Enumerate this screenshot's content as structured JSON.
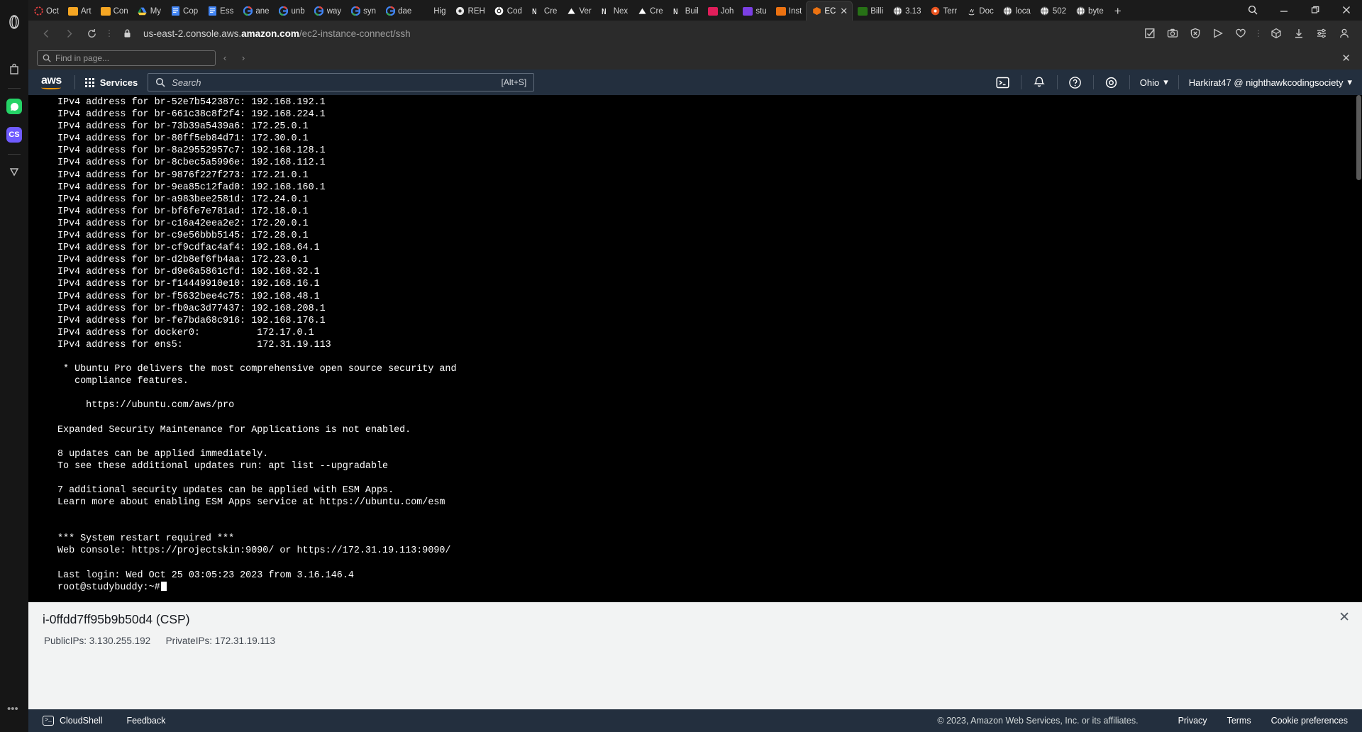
{
  "browser": {
    "tabs": [
      {
        "label": "Oct",
        "icon": "clock-icon",
        "color": "#e84040"
      },
      {
        "label": "Art",
        "icon": "note-icon",
        "color": "#f5a623"
      },
      {
        "label": "Con",
        "icon": "note-icon",
        "color": "#f5a623"
      },
      {
        "label": "My",
        "icon": "google-drive-icon",
        "color": "#2196f3"
      },
      {
        "label": "Cop",
        "icon": "google-docs-icon",
        "color": "#4285f4"
      },
      {
        "label": "Ess",
        "icon": "google-docs-icon",
        "color": "#4285f4"
      },
      {
        "label": "ane",
        "icon": "google-icon",
        "color": "#ffffff"
      },
      {
        "label": "unb",
        "icon": "google-icon",
        "color": "#ffffff"
      },
      {
        "label": "way",
        "icon": "google-icon",
        "color": "#ffffff"
      },
      {
        "label": "syn",
        "icon": "google-icon",
        "color": "#ffffff"
      },
      {
        "label": "dae",
        "icon": "google-icon",
        "color": "#ffffff"
      },
      {
        "label": "Hig",
        "icon": "blank-icon",
        "color": "#888888"
      },
      {
        "label": "REH",
        "icon": "circle-icon",
        "color": "#dddddd"
      },
      {
        "label": "Cod",
        "icon": "gitlab-icon",
        "color": "#ffffff"
      },
      {
        "label": "Cre",
        "icon": "netlify-icon",
        "color": "#ffffff"
      },
      {
        "label": "Ver",
        "icon": "vercel-icon",
        "color": "#ffffff"
      },
      {
        "label": "Nex",
        "icon": "netlify-icon",
        "color": "#ffffff"
      },
      {
        "label": "Cre",
        "icon": "vercel-icon",
        "color": "#ffffff"
      },
      {
        "label": "Buil",
        "icon": "netlify-icon",
        "color": "#ffffff"
      },
      {
        "label": "Joh",
        "icon": "slack-icon",
        "color": "#e01e5a"
      },
      {
        "label": "stu",
        "icon": "discord-icon",
        "color": "#7b3fe4"
      },
      {
        "label": "Inst",
        "icon": "instance-icon",
        "color": "#ec7211"
      },
      {
        "label": "EC",
        "icon": "aws-ec2-icon",
        "color": "#ec7211",
        "active": true,
        "closable": true
      },
      {
        "label": "Billi",
        "icon": "aws-billing-icon",
        "color": "#277116"
      },
      {
        "label": "3.13",
        "icon": "globe-icon",
        "color": "#ffffff"
      },
      {
        "label": "Terr",
        "icon": "ubuntu-icon",
        "color": "#e95420"
      },
      {
        "label": "Doc",
        "icon": "java-icon",
        "color": "#e0e0e0"
      },
      {
        "label": "loca",
        "icon": "globe-icon",
        "color": "#ffffff"
      },
      {
        "label": "502",
        "icon": "globe-icon",
        "color": "#ffffff"
      },
      {
        "label": "byte",
        "icon": "globe-icon",
        "color": "#ffffff"
      }
    ],
    "new_tab_label": "+",
    "window_controls": {
      "search": "search-icon",
      "minimize": "—",
      "restore": "❐",
      "close": "✕"
    },
    "address": {
      "scheme_host_prefix": "us-east-2.console.aws.",
      "host_strong": "amazon.com",
      "path": "/ec2-instance-connect/ssh",
      "lock": "lock-icon",
      "reload": "reload-icon",
      "back": "back-icon",
      "forward": "forward-icon"
    }
  },
  "findbar": {
    "placeholder": "Find in page...",
    "prev_label": "‹",
    "next_label": "›",
    "close_label": "✕"
  },
  "aws_header": {
    "logo_text": "aws",
    "services_label": "Services",
    "search_placeholder": "Search",
    "search_shortcut": "[Alt+S]",
    "region": "Ohio",
    "account": "Harkirat47 @ nighthawkcodingsociety",
    "icons": [
      "cloudshell-icon",
      "notifications-icon",
      "help-icon",
      "settings-icon"
    ]
  },
  "terminal": {
    "lines": [
      "IPv4 address for br-52e7b542387c: 192.168.192.1",
      "IPv4 address for br-661c38c8f2f4: 192.168.224.1",
      "IPv4 address for br-73b39a5439a6: 172.25.0.1",
      "IPv4 address for br-80ff5eb84d71: 172.30.0.1",
      "IPv4 address for br-8a29552957c7: 192.168.128.1",
      "IPv4 address for br-8cbec5a5996e: 192.168.112.1",
      "IPv4 address for br-9876f227f273: 172.21.0.1",
      "IPv4 address for br-9ea85c12fad0: 192.168.160.1",
      "IPv4 address for br-a983bee2581d: 172.24.0.1",
      "IPv4 address for br-bf6fe7e781ad: 172.18.0.1",
      "IPv4 address for br-c16a42eea2e2: 172.20.0.1",
      "IPv4 address for br-c9e56bbb5145: 172.28.0.1",
      "IPv4 address for br-cf9cdfac4af4: 192.168.64.1",
      "IPv4 address for br-d2b8ef6fb4aa: 172.23.0.1",
      "IPv4 address for br-d9e6a5861cfd: 192.168.32.1",
      "IPv4 address for br-f14449910e10: 192.168.16.1",
      "IPv4 address for br-f5632bee4c75: 192.168.48.1",
      "IPv4 address for br-fb0ac3d77437: 192.168.208.1",
      "IPv4 address for br-fe7bda68c916: 192.168.176.1",
      "IPv4 address for docker0:          172.17.0.1",
      "IPv4 address for ens5:             172.31.19.113",
      "",
      " * Ubuntu Pro delivers the most comprehensive open source security and",
      "   compliance features.",
      "",
      "     https://ubuntu.com/aws/pro",
      "",
      "Expanded Security Maintenance for Applications is not enabled.",
      "",
      "8 updates can be applied immediately.",
      "To see these additional updates run: apt list --upgradable",
      "",
      "7 additional security updates can be applied with ESM Apps.",
      "Learn more about enabling ESM Apps service at https://ubuntu.com/esm",
      "",
      "",
      "*** System restart required ***",
      "Web console: https://projectskin:9090/ or https://172.31.19.113:9090/",
      "",
      "Last login: Wed Oct 25 03:05:23 2023 from 3.16.146.4"
    ],
    "prompt": "root@studybuddy:~#"
  },
  "info_panel": {
    "title": "i-0ffdd7ff95b9b50d4 (CSP)",
    "public_ips_label": "PublicIPs:",
    "public_ips_value": "3.130.255.192",
    "private_ips_label": "PrivateIPs:",
    "private_ips_value": "172.31.19.113",
    "close_label": "✕"
  },
  "footer": {
    "cloudshell_label": "CloudShell",
    "feedback_label": "Feedback",
    "copyright": "© 2023, Amazon Web Services, Inc. or its affiliates.",
    "privacy_label": "Privacy",
    "terms_label": "Terms",
    "cookie_label": "Cookie preferences"
  }
}
